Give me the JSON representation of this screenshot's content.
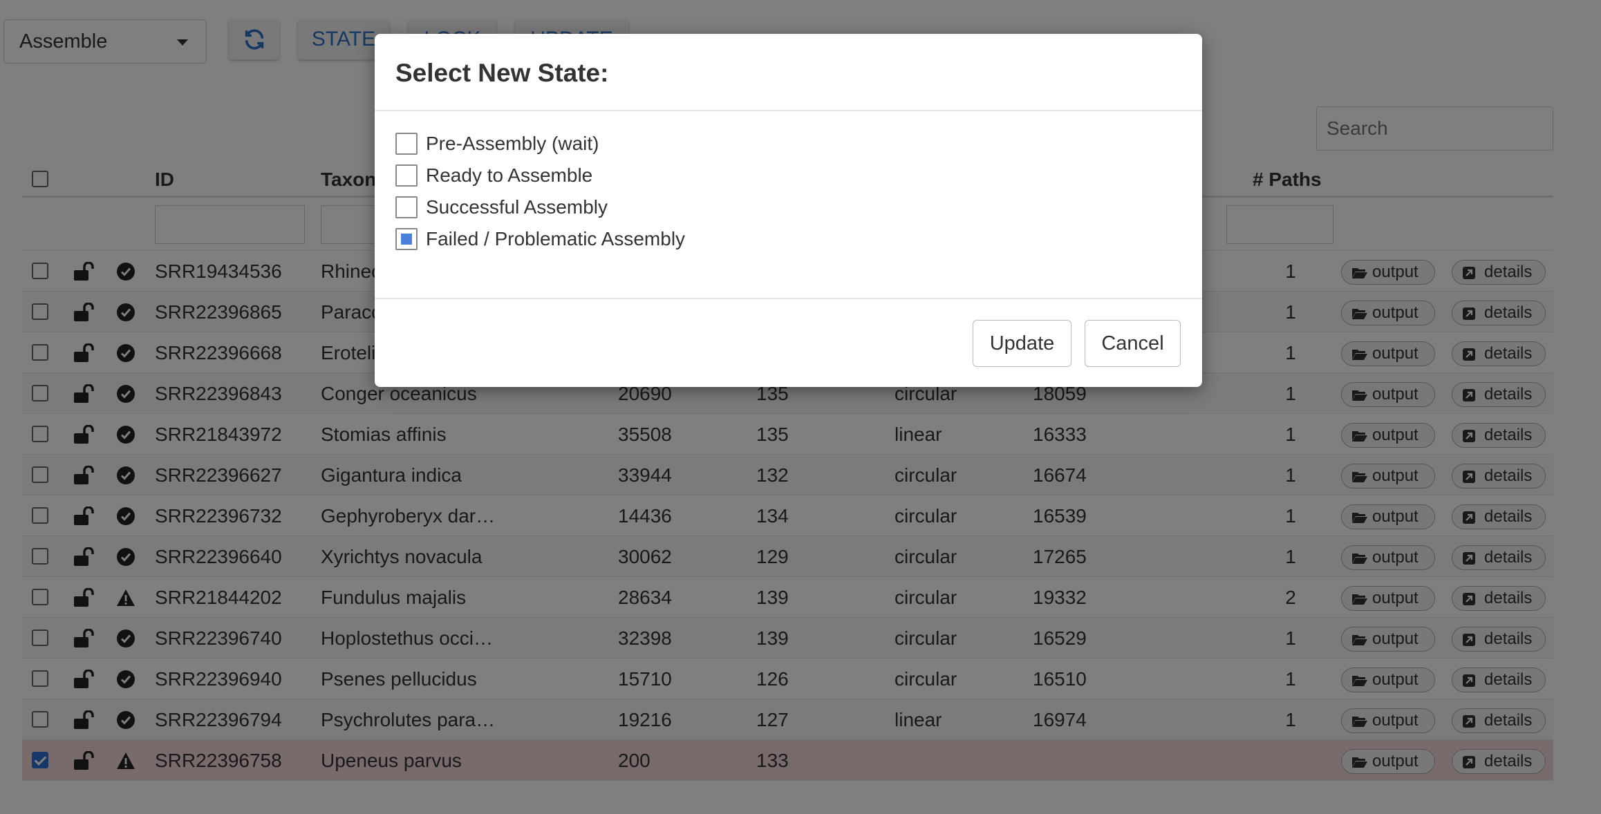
{
  "toolbar": {
    "view_select": "Assemble",
    "refresh_icon": "refresh-icon",
    "state_button": "STATE",
    "lock_button": "LOCK",
    "update_button": "UPDATE"
  },
  "search": {
    "placeholder": "Search"
  },
  "table": {
    "columns": [
      "ID",
      "Taxon",
      "",
      "",
      "",
      "",
      "# Paths"
    ],
    "rows": [
      {
        "id": "SRR19434536",
        "taxon": "Rhinec",
        "c1": "",
        "c2": "",
        "topology": "",
        "length": "",
        "paths": "1",
        "status": "check",
        "selected": false
      },
      {
        "id": "SRR22396865",
        "taxon": "Paraco",
        "c1": "",
        "c2": "",
        "topology": "",
        "length": "",
        "paths": "1",
        "status": "check",
        "selected": false
      },
      {
        "id": "SRR22396668",
        "taxon": "Eroteli",
        "c1": "",
        "c2": "",
        "topology": "",
        "length": "",
        "paths": "1",
        "status": "check",
        "selected": false
      },
      {
        "id": "SRR22396843",
        "taxon": "Conger oceanicus",
        "c1": "20690",
        "c2": "135",
        "topology": "circular",
        "length": "18059",
        "paths": "1",
        "status": "check",
        "selected": false
      },
      {
        "id": "SRR21843972",
        "taxon": "Stomias affinis",
        "c1": "35508",
        "c2": "135",
        "topology": "linear",
        "length": "16333",
        "paths": "1",
        "status": "check",
        "selected": false
      },
      {
        "id": "SRR22396627",
        "taxon": "Gigantura indica",
        "c1": "33944",
        "c2": "132",
        "topology": "circular",
        "length": "16674",
        "paths": "1",
        "status": "check",
        "selected": false
      },
      {
        "id": "SRR22396732",
        "taxon": "Gephyroberyx dar…",
        "c1": "14436",
        "c2": "134",
        "topology": "circular",
        "length": "16539",
        "paths": "1",
        "status": "check",
        "selected": false
      },
      {
        "id": "SRR22396640",
        "taxon": "Xyrichtys novacula",
        "c1": "30062",
        "c2": "129",
        "topology": "circular",
        "length": "17265",
        "paths": "1",
        "status": "check",
        "selected": false
      },
      {
        "id": "SRR21844202",
        "taxon": "Fundulus majalis",
        "c1": "28634",
        "c2": "139",
        "topology": "circular",
        "length": "19332",
        "paths": "2",
        "status": "warning",
        "selected": false
      },
      {
        "id": "SRR22396740",
        "taxon": "Hoplostethus occi…",
        "c1": "32398",
        "c2": "139",
        "topology": "circular",
        "length": "16529",
        "paths": "1",
        "status": "check",
        "selected": false
      },
      {
        "id": "SRR22396940",
        "taxon": "Psenes pellucidus",
        "c1": "15710",
        "c2": "126",
        "topology": "circular",
        "length": "16510",
        "paths": "1",
        "status": "check",
        "selected": false
      },
      {
        "id": "SRR22396794",
        "taxon": "Psychrolutes para…",
        "c1": "19216",
        "c2": "127",
        "topology": "linear",
        "length": "16974",
        "paths": "1",
        "status": "check",
        "selected": false
      },
      {
        "id": "SRR22396758",
        "taxon": "Upeneus parvus",
        "c1": "200",
        "c2": "133",
        "topology": "",
        "length": "",
        "paths": "",
        "status": "warning",
        "selected": true
      }
    ],
    "output_label": "output",
    "details_label": "details"
  },
  "modal": {
    "title": "Select New State:",
    "options": [
      {
        "label": "Pre-Assembly (wait)",
        "checked": false
      },
      {
        "label": "Ready to Assemble",
        "checked": false
      },
      {
        "label": "Successful Assembly",
        "checked": false
      },
      {
        "label": "Failed / Problematic Assembly",
        "checked": true
      }
    ],
    "update_label": "Update",
    "cancel_label": "Cancel"
  },
  "colors": {
    "accent": "#2f6fc4",
    "selected_row": "#f2d6d9",
    "backdrop": "rgba(0,0,0,0.5)"
  }
}
